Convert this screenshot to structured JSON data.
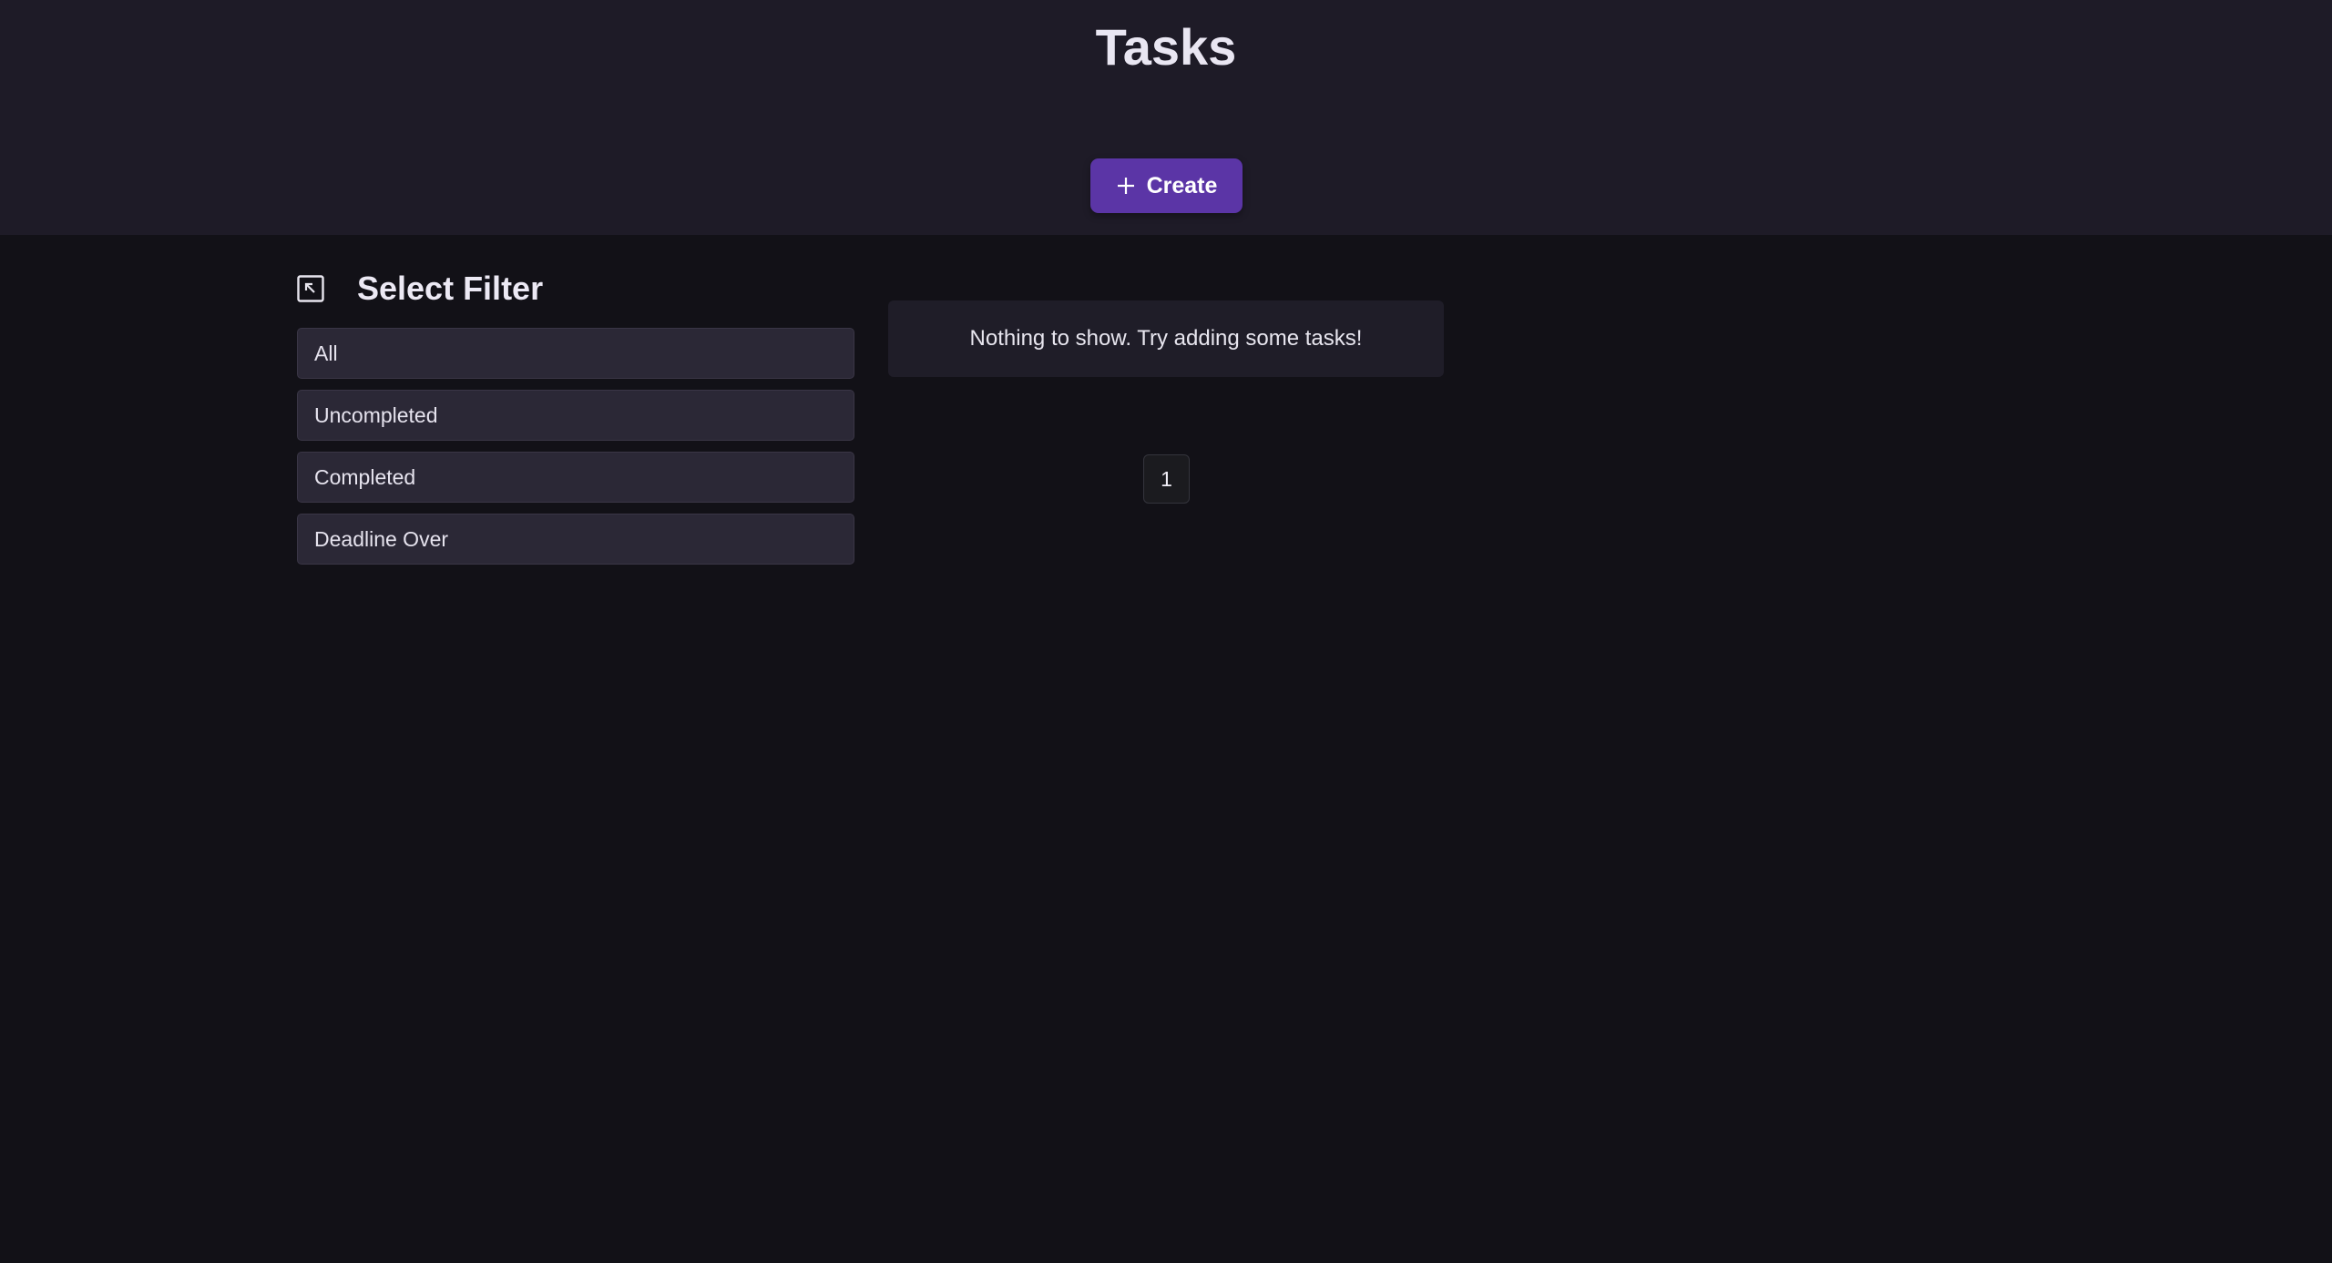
{
  "header": {
    "title": "Tasks",
    "create_label": "Create",
    "create_icon": "plus-icon"
  },
  "sidebar": {
    "title": "Select Filter",
    "collapse_icon": "collapse-arrow-icon",
    "items": [
      {
        "label": "All"
      },
      {
        "label": "Uncompleted"
      },
      {
        "label": "Completed"
      },
      {
        "label": "Deadline Over"
      }
    ]
  },
  "main": {
    "empty_message": "Nothing to show. Try adding some tasks!"
  },
  "pagination": {
    "current_page": "1"
  },
  "colors": {
    "background": "#121117",
    "header_background": "#1e1b27",
    "accent": "#5b35a6",
    "filter_item": "#2b2836",
    "card": "#1f1d28"
  }
}
